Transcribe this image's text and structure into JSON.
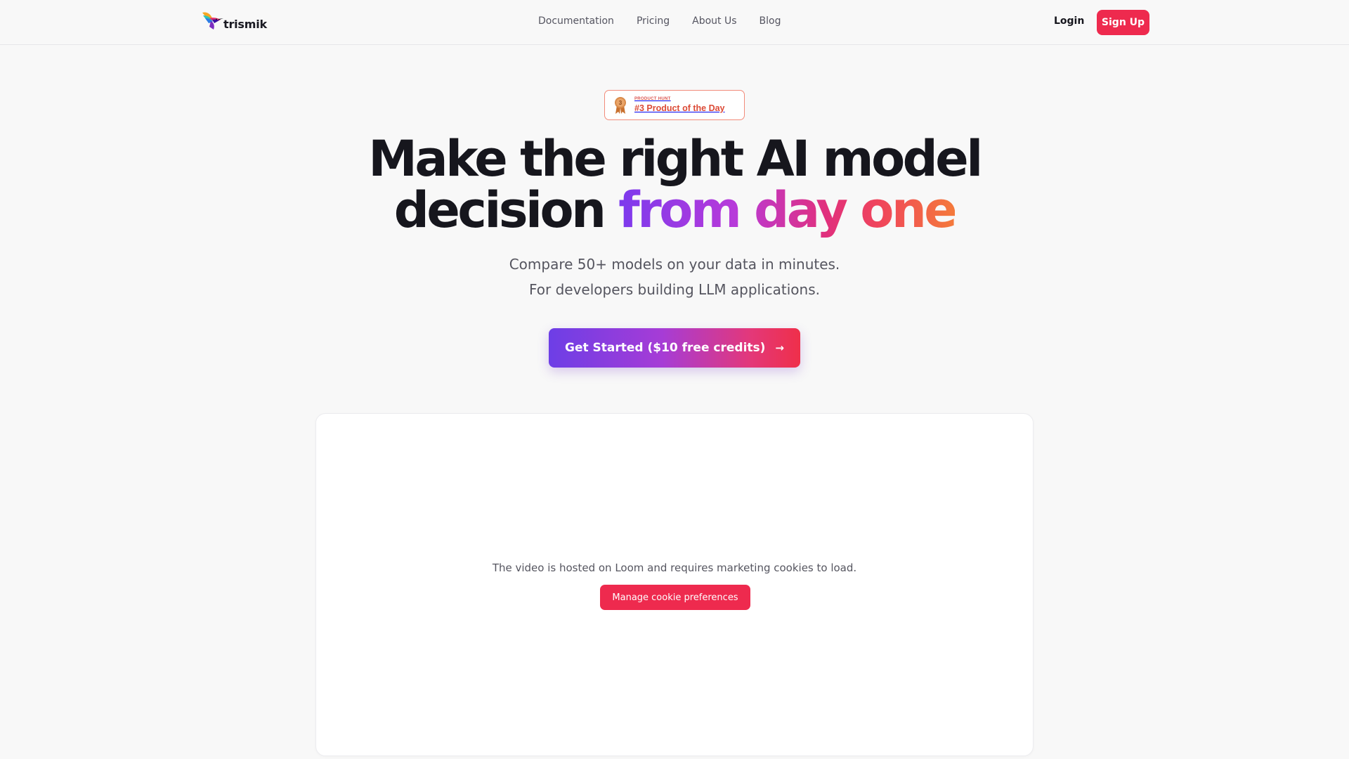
{
  "brand": {
    "name": "trismik",
    "colors": {
      "primary": "#ee2a4e",
      "gradient_start": "#6d3ee6",
      "gradient_end": "#ef2f4a"
    }
  },
  "nav": {
    "items": [
      {
        "label": "Documentation"
      },
      {
        "label": "Pricing"
      },
      {
        "label": "About Us"
      },
      {
        "label": "Blog"
      }
    ],
    "login_label": "Login",
    "signup_label": "Sign Up"
  },
  "badge": {
    "icon": "medal-icon",
    "small_label": "PRODUCT HUNT",
    "main_label": "#3 Product of the Day",
    "rank": "3"
  },
  "hero": {
    "title_line1": "Make the right AI model",
    "title_line2_plain": "decision",
    "title_line2_highlight": "from day one",
    "subtitle_line1": "Compare 50+ models on your data in minutes.",
    "subtitle_line2": "For developers building LLM applications.",
    "cta_label": "Get Started ($10 free credits)",
    "cta_icon": "arrow-right-icon"
  },
  "video": {
    "message": "The video is hosted on Loom and requires marketing cookies to load.",
    "cookie_button_label": "Manage cookie preferences"
  }
}
